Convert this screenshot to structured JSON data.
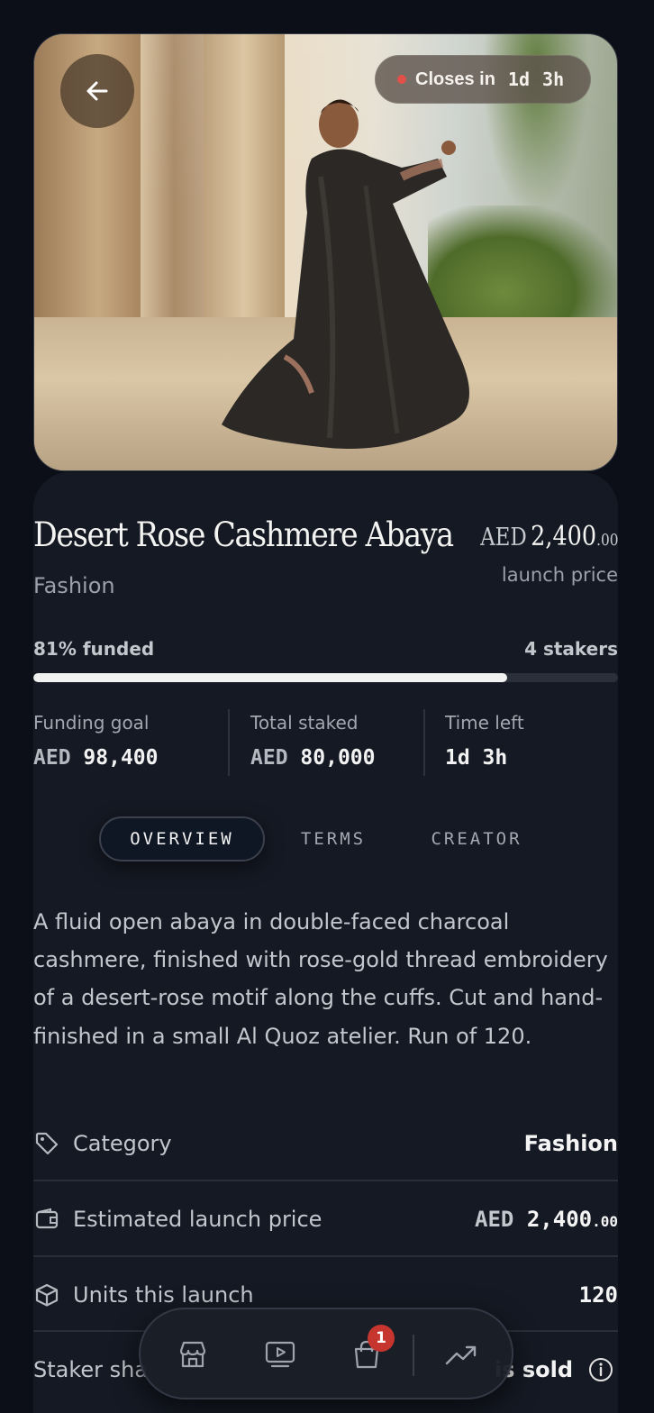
{
  "hero": {
    "closes_label": "Closes in",
    "closes_time": "1d  3h"
  },
  "product": {
    "title": "Desert Rose Cashmere Abaya",
    "category": "Fashion",
    "price_currency": "AED",
    "price_amount": "2,400",
    "price_decimals": ".00",
    "price_sub": "launch price"
  },
  "funding": {
    "percent_label": "81% funded",
    "percent": 81,
    "stakers_label": "4 stakers"
  },
  "stats": [
    {
      "label": "Funding goal",
      "unit": "AED",
      "value": "98,400"
    },
    {
      "label": "Total staked",
      "unit": "AED",
      "value": "80,000"
    },
    {
      "label": "Time left",
      "unit": "",
      "value": "1d 3h"
    }
  ],
  "tabs": [
    "OVERVIEW",
    "TERMS",
    "CREATOR"
  ],
  "description": "A fluid open abaya in double-faced charcoal cashmere, finished with rose-gold thread embroidery of a desert-rose motif along the cuffs. Cut and hand-finished in a small Al Quoz atelier. Run of 120.",
  "details": [
    {
      "label": "Category",
      "value": "Fashion"
    },
    {
      "label": "Estimated launch price",
      "currency": "AED",
      "value": "2,400",
      "decimals": ".00"
    },
    {
      "label": "Units this launch",
      "value": "120"
    },
    {
      "label": "Staker sha",
      "value": "is sold"
    }
  ],
  "nav": {
    "cart_badge": "1"
  }
}
